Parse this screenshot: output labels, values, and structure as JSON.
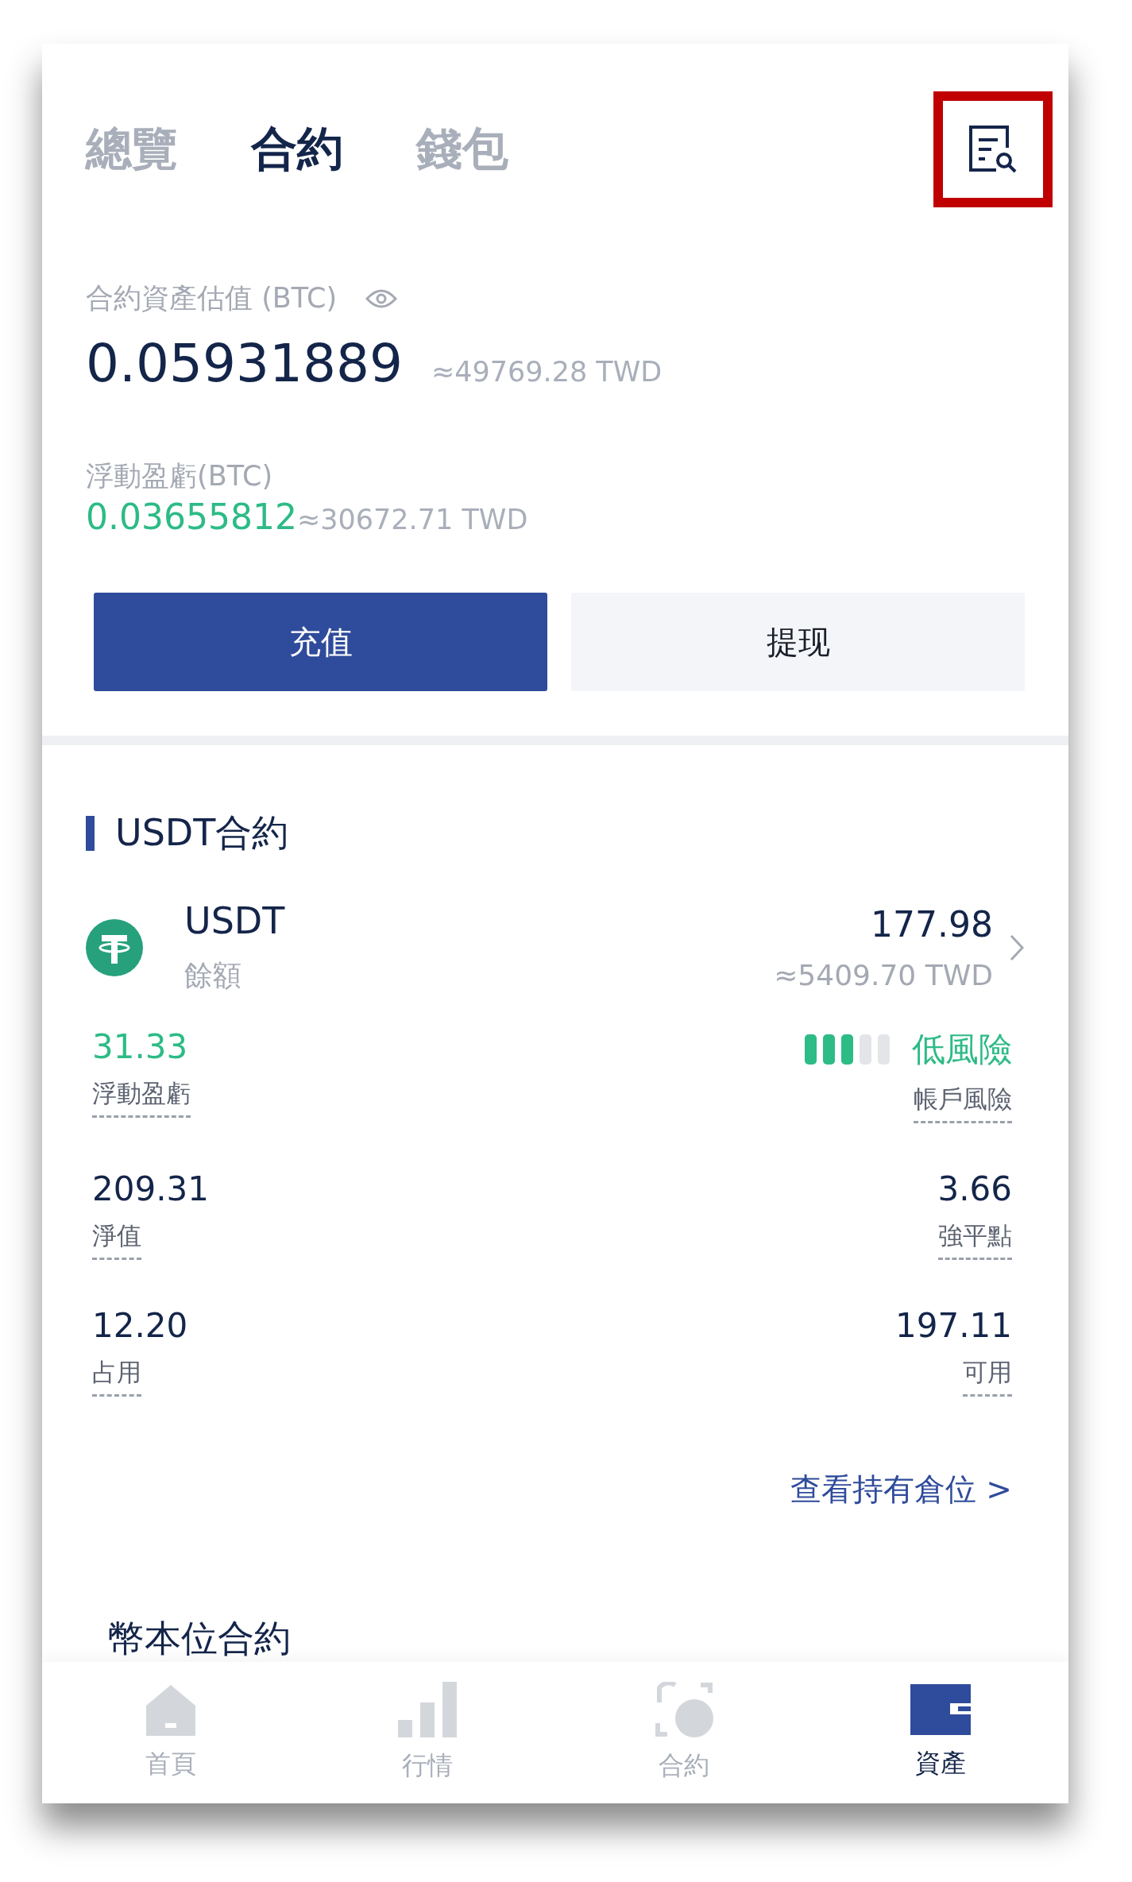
{
  "tabs": [
    {
      "label": "總覽",
      "selected": false
    },
    {
      "label": "合約",
      "selected": true
    },
    {
      "label": "錢包",
      "selected": false
    }
  ],
  "header_action": {
    "highlighted": true
  },
  "summary": {
    "label": "合約資產估值 (BTC)",
    "value": "0.05931889",
    "approx": "≈49769.28 TWD",
    "pnl_label": "浮動盈虧(BTC)",
    "pnl_value": "0.03655812",
    "pnl_approx": "≈30672.71 TWD"
  },
  "buttons": [
    {
      "label": "充值",
      "kind": "primary"
    },
    {
      "label": "提现",
      "kind": "secondary"
    }
  ],
  "usdt_section": {
    "title": "USDT合約",
    "asset": "USDT",
    "balance_label": "餘額",
    "balance": "177.98",
    "balance_approx": "≈5409.70 TWD",
    "risk": {
      "level": 0.6,
      "label": "低風險",
      "caption": "帳戶風險"
    },
    "stats": [
      {
        "value": "31.33",
        "label": "浮動盈虧",
        "kind": "profit"
      },
      {
        "value": "209.31",
        "label": "淨值",
        "kind": "plain"
      },
      {
        "value": "3.66",
        "label": "強平點",
        "kind": "plain"
      },
      {
        "value": "12.20",
        "label": "占用",
        "kind": "plain"
      },
      {
        "value": "197.11",
        "label": "可用",
        "kind": "plain"
      }
    ],
    "link": "查看持有倉位 >"
  },
  "coin_section": {
    "title": "幣本位合約"
  },
  "nav": [
    {
      "label": "首頁",
      "kind": "home",
      "selected": false
    },
    {
      "label": "行情",
      "kind": "chart",
      "selected": false
    },
    {
      "label": "合約",
      "kind": "contract",
      "selected": false
    },
    {
      "label": "資產",
      "kind": "wallet",
      "selected": true
    }
  ]
}
